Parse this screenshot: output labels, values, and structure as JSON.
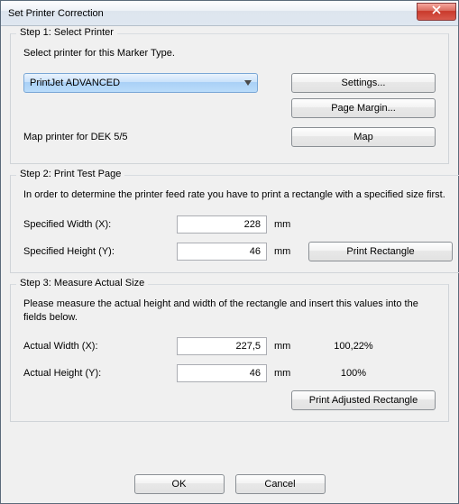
{
  "window": {
    "title": "Set Printer Correction"
  },
  "step1": {
    "title": "Step 1: Select Printer",
    "prompt": "Select printer for this Marker Type.",
    "printer": "PrintJet ADVANCED",
    "settings_label": "Settings...",
    "page_margin_label": "Page Margin...",
    "map_line": "Map printer for DEK 5/5",
    "map_label": "Map"
  },
  "step2": {
    "title": "Step 2: Print Test Page",
    "prompt": "In order to determine the printer feed rate you have to print a rectangle with a specified size first.",
    "width_label": "Specified Width (X):",
    "height_label": "Specified Height (Y):",
    "width_value": "228",
    "height_value": "46",
    "unit": "mm",
    "print_label": "Print Rectangle"
  },
  "step3": {
    "title": "Step 3: Measure Actual Size",
    "prompt": "Please measure the actual height and width of the rectangle and insert this values into the fields below.",
    "width_label": "Actual Width (X):",
    "height_label": "Actual Height (Y):",
    "width_value": "227,5",
    "height_value": "46",
    "unit": "mm",
    "width_pct": "100,22%",
    "height_pct": "100%",
    "print_label": "Print Adjusted Rectangle"
  },
  "footer": {
    "ok_label": "OK",
    "cancel_label": "Cancel"
  }
}
